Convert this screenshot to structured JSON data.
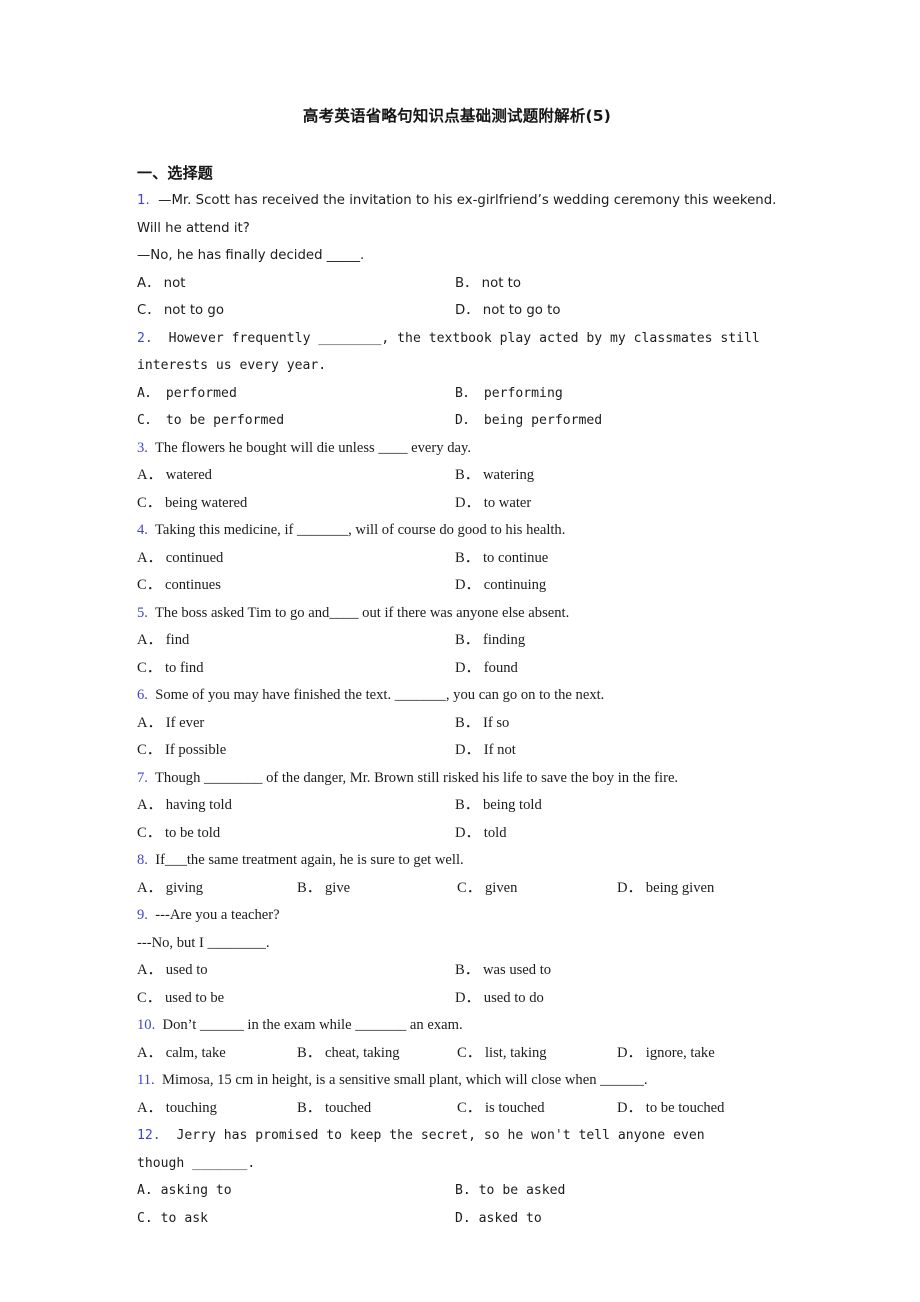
{
  "document": {
    "title": "高考英语省略句知识点基础测试题附解析(5)",
    "section_heading": "一、选择题",
    "number_color": "#4444c8",
    "text_color": "#1c1c1c",
    "background_color": "#ffffff"
  },
  "questions": [
    {
      "number": "1.",
      "font": "sans",
      "lines": [
        "—Mr. Scott has received the invitation to his ex-girlfriend’s wedding ceremony this weekend.",
        "Will he attend it?",
        "—No, he has finally decided _____."
      ],
      "columns": 2,
      "options": [
        {
          "letter": "A．",
          "text": "not"
        },
        {
          "letter": "B．",
          "text": "not to"
        },
        {
          "letter": "C．",
          "text": "not to go"
        },
        {
          "letter": "D．",
          "text": "not to go to"
        }
      ]
    },
    {
      "number": "2.",
      "font": "mono",
      "lines": [
        "However frequently ________, the textbook play acted by my classmates still",
        "interests us every year."
      ],
      "columns": 2,
      "options": [
        {
          "letter": "A．",
          "text": "performed"
        },
        {
          "letter": "B．",
          "text": "performing"
        },
        {
          "letter": "C．",
          "text": "to be performed"
        },
        {
          "letter": "D．",
          "text": "being performed"
        }
      ]
    },
    {
      "number": "3.",
      "font": "serif",
      "lines": [
        "The flowers he bought will die unless ____ every day."
      ],
      "columns": 2,
      "options": [
        {
          "letter": "A．",
          "text": "watered"
        },
        {
          "letter": "B．",
          "text": "watering"
        },
        {
          "letter": "C．",
          "text": "being watered"
        },
        {
          "letter": "D．",
          "text": "to water"
        }
      ]
    },
    {
      "number": "4.",
      "font": "serif",
      "lines": [
        "Taking this medicine, if _______, will of course do good to his health."
      ],
      "columns": 2,
      "options": [
        {
          "letter": "A．",
          "text": "continued"
        },
        {
          "letter": "B．",
          "text": "to continue"
        },
        {
          "letter": "C．",
          "text": "continues"
        },
        {
          "letter": "D．",
          "text": "continuing"
        }
      ]
    },
    {
      "number": "5.",
      "font": "serif",
      "lines": [
        "The boss asked Tim to go and____ out if there was anyone else absent."
      ],
      "columns": 2,
      "options": [
        {
          "letter": "A．",
          "text": "find"
        },
        {
          "letter": "B．",
          "text": "finding"
        },
        {
          "letter": "C．",
          "text": "to find"
        },
        {
          "letter": "D．",
          "text": "found"
        }
      ]
    },
    {
      "number": "6.",
      "font": "serif",
      "lines": [
        "Some of you may have finished the text. _______, you can go on to the next."
      ],
      "columns": 2,
      "options": [
        {
          "letter": "A．",
          "text": "If ever"
        },
        {
          "letter": "B．",
          "text": "If so"
        },
        {
          "letter": "C．",
          "text": "If possible"
        },
        {
          "letter": "D．",
          "text": "If not"
        }
      ]
    },
    {
      "number": "7.",
      "font": "serif",
      "lines": [
        "Though ________ of the danger, Mr. Brown still risked his life to save the boy in the fire."
      ],
      "columns": 2,
      "options": [
        {
          "letter": "A．",
          "text": "having told"
        },
        {
          "letter": "B．",
          "text": "being told"
        },
        {
          "letter": "C．",
          "text": "to be told"
        },
        {
          "letter": "D．",
          "text": "told"
        }
      ]
    },
    {
      "number": "8.",
      "font": "serif",
      "lines": [
        "If___the same treatment again, he is sure to get well."
      ],
      "columns": 4,
      "options": [
        {
          "letter": "A．",
          "text": "giving"
        },
        {
          "letter": "B．",
          "text": "give"
        },
        {
          "letter": "C．",
          "text": "given"
        },
        {
          "letter": "D．",
          "text": "being given"
        }
      ]
    },
    {
      "number": "9.",
      "font": "serif",
      "lines": [
        "---Are you a teacher?",
        "---No, but I ________."
      ],
      "columns": 2,
      "options": [
        {
          "letter": "A．",
          "text": "used to"
        },
        {
          "letter": "B．",
          "text": "was used to"
        },
        {
          "letter": "C．",
          "text": "used to be"
        },
        {
          "letter": "D．",
          "text": "used to do"
        }
      ]
    },
    {
      "number": "10.",
      "font": "serif",
      "lines": [
        "Don’t ______ in the exam while _______ an exam."
      ],
      "columns": 4,
      "options": [
        {
          "letter": "A．",
          "text": "calm, take"
        },
        {
          "letter": "B．",
          "text": "cheat, taking"
        },
        {
          "letter": "C．",
          "text": "list, taking"
        },
        {
          "letter": "D．",
          "text": "ignore, take"
        }
      ]
    },
    {
      "number": "11.",
      "font": "serif",
      "lines": [
        "Mimosa, 15 cm in height, is a sensitive small plant, which will close when ______."
      ],
      "columns": 4,
      "options": [
        {
          "letter": "A．",
          "text": "touching"
        },
        {
          "letter": "B．",
          "text": "touched"
        },
        {
          "letter": "C．",
          "text": "is touched"
        },
        {
          "letter": "D．",
          "text": "to be touched"
        }
      ]
    },
    {
      "number": "12.",
      "font": "mono",
      "lines": [
        "Jerry has promised to keep the secret, so he won't tell anyone even",
        "though _______."
      ],
      "columns": 2,
      "options": [
        {
          "letter": "A.",
          "text": "asking to"
        },
        {
          "letter": "B.",
          "text": "to be asked"
        },
        {
          "letter": "C.",
          "text": "to ask"
        },
        {
          "letter": "D.",
          "text": "asked to"
        }
      ]
    }
  ]
}
